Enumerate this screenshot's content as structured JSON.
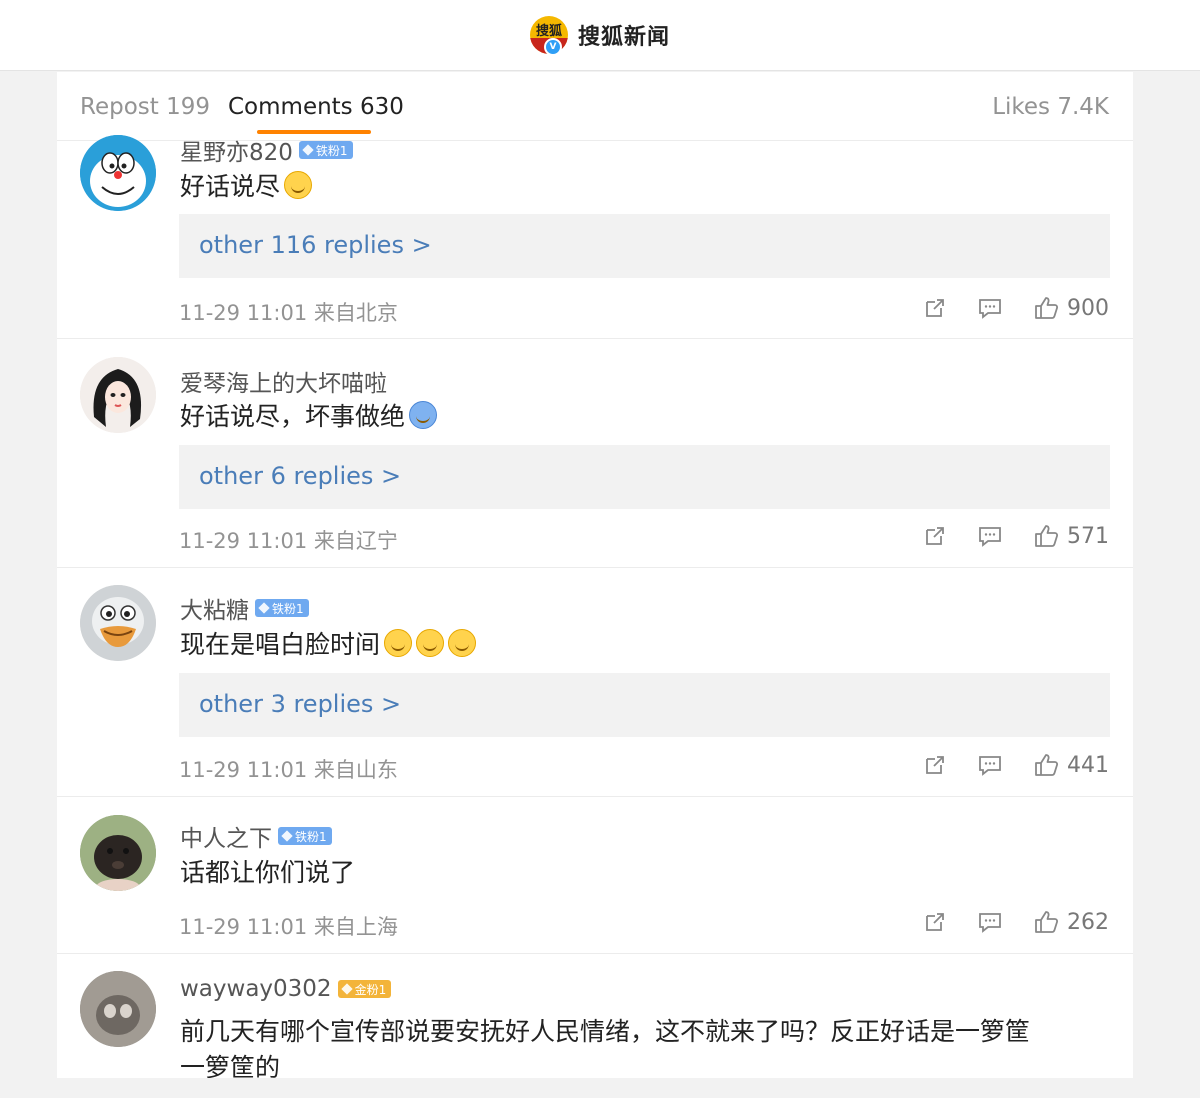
{
  "header": {
    "site_name": "搜狐新闻",
    "logo_text": "搜狐",
    "verified_mark": "V"
  },
  "tabs": {
    "repost": "Repost 199",
    "comments": "Comments 630",
    "likes": "Likes 7.4K"
  },
  "colors": {
    "accent": "#ff8200",
    "link": "#4a7db8",
    "fan_badge_blue": "#6fa9f0",
    "fan_badge_gold": "#f3b43a"
  },
  "comments": [
    {
      "username": "星野亦820",
      "badge": "铁粉1",
      "text": "好话说尽",
      "replies": "other 116 replies >",
      "time": "11-29 11:01 来自北京",
      "likes": "900"
    },
    {
      "username": "爱琴海上的大坏喵啦",
      "badge": "",
      "text": "好话说尽，坏事做绝",
      "replies": "other 6 replies >",
      "time": "11-29 11:01 来自辽宁",
      "likes": "571"
    },
    {
      "username": "大粘糖",
      "badge": "铁粉1",
      "text": "现在是唱白脸时间",
      "replies": "other 3 replies >",
      "time": "11-29 11:01 来自山东",
      "likes": "441"
    },
    {
      "username": "中人之下",
      "badge": "铁粉1",
      "text": "话都让你们说了",
      "replies": "",
      "time": "11-29 11:01 来自上海",
      "likes": "262"
    },
    {
      "username": "wayway0302",
      "badge": "金粉1",
      "text_line1": "前几天有哪个宣传部说要安抚好人民情绪，这不就来了吗？反正好话是一箩筐",
      "text_line2": "一箩筐的"
    }
  ]
}
